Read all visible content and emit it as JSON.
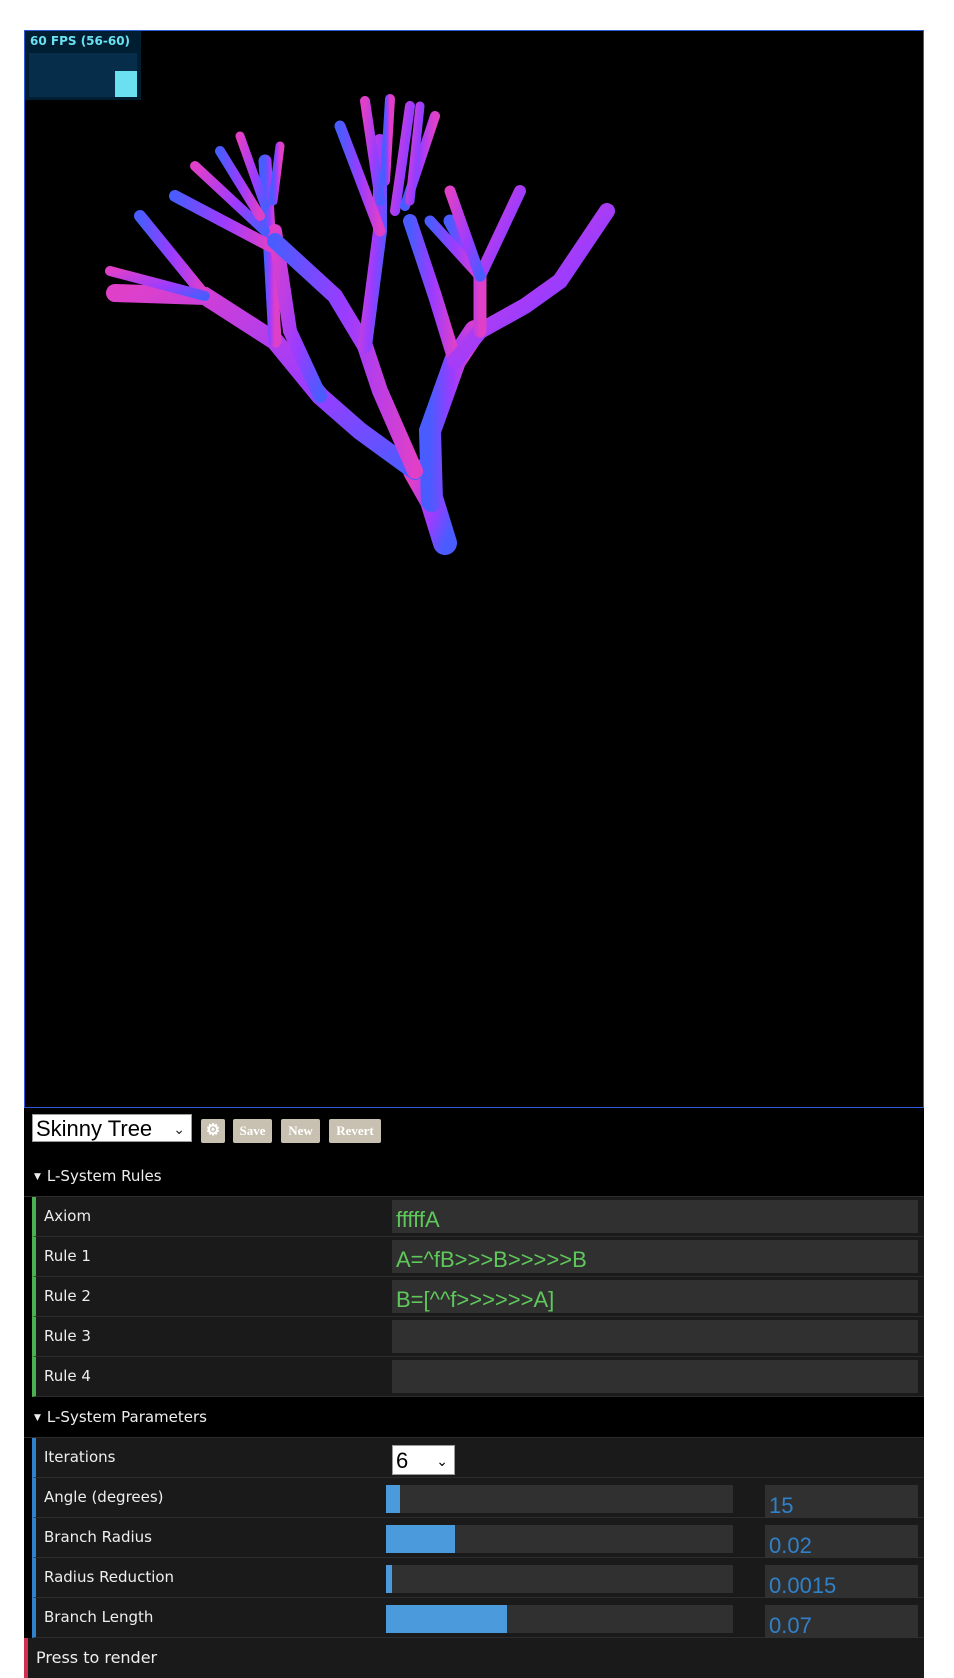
{
  "fps": {
    "label": "60 FPS (56-60)",
    "color": "#6be0f0",
    "level": 0.6
  },
  "scene": {
    "background": "#000000",
    "branch_colors": [
      "#9b3cff",
      "#e040c8",
      "#4a5cff"
    ]
  },
  "preset": {
    "selected": "Skinny Tree",
    "buttons": {
      "save": "Save",
      "new": "New",
      "revert": "Revert"
    },
    "gear_icon": "gear-icon"
  },
  "rules_folder": {
    "title": "L-System Rules",
    "rows": [
      {
        "label": "Axiom",
        "value": "fffffA"
      },
      {
        "label": "Rule 1",
        "value": "A=^fB>>>B>>>>>B"
      },
      {
        "label": "Rule 2",
        "value": "B=[^^f>>>>>>A]"
      },
      {
        "label": "Rule 3",
        "value": ""
      },
      {
        "label": "Rule 4",
        "value": ""
      }
    ]
  },
  "params_folder": {
    "title": "L-System Parameters",
    "iterations": {
      "label": "Iterations",
      "value": "6"
    },
    "sliders": [
      {
        "label": "Angle (degrees)",
        "value": "15",
        "fraction": 0.04
      },
      {
        "label": "Branch Radius",
        "value": "0.02",
        "fraction": 0.2
      },
      {
        "label": "Radius Reduction",
        "value": "0.0015",
        "fraction": 0.015
      },
      {
        "label": "Branch Length",
        "value": "0.07",
        "fraction": 0.35
      }
    ]
  },
  "render": {
    "label": "Press to render",
    "accent": "#d03050"
  }
}
